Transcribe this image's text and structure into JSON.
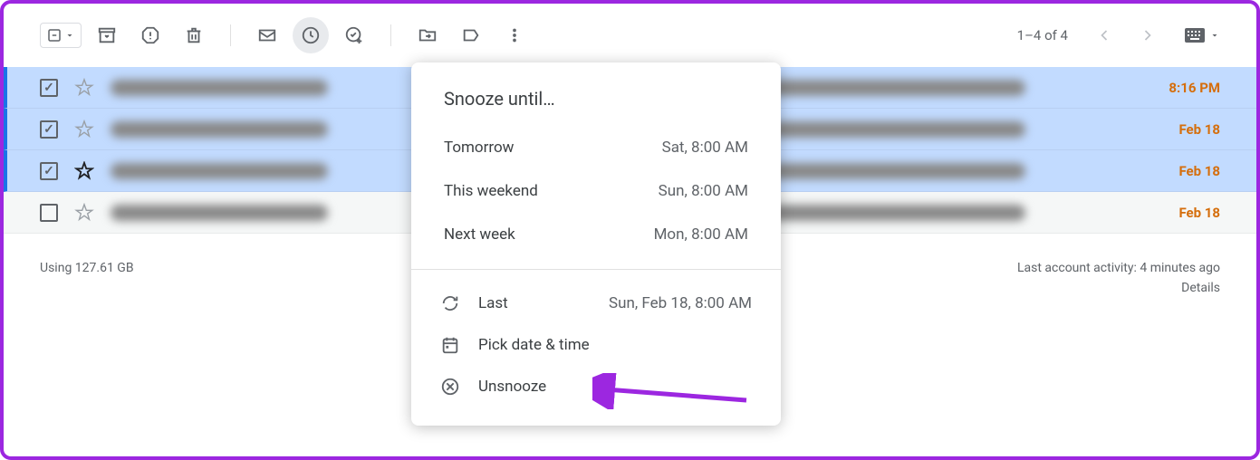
{
  "toolbar": {
    "pagination": "1–4 of 4"
  },
  "emails": [
    {
      "selected": true,
      "starred": false,
      "date": "8:16 PM"
    },
    {
      "selected": true,
      "starred": false,
      "date": "Feb 18"
    },
    {
      "selected": true,
      "starred": true,
      "date": "Feb 18"
    },
    {
      "selected": false,
      "starred": false,
      "date": "Feb 18"
    }
  ],
  "snooze": {
    "title": "Snooze until…",
    "options": [
      {
        "label": "Tomorrow",
        "time": "Sat, 8:00 AM"
      },
      {
        "label": "This weekend",
        "time": "Sun, 8:00 AM"
      },
      {
        "label": "Next week",
        "time": "Mon, 8:00 AM"
      }
    ],
    "last_label": "Last",
    "last_time": "Sun, Feb 18, 8:00 AM",
    "pick_label": "Pick date & time",
    "unsnooze_label": "Unsnooze"
  },
  "footer": {
    "storage": "Using 127.61 GB",
    "activity": "Last account activity: 4 minutes ago",
    "details": "Details"
  }
}
